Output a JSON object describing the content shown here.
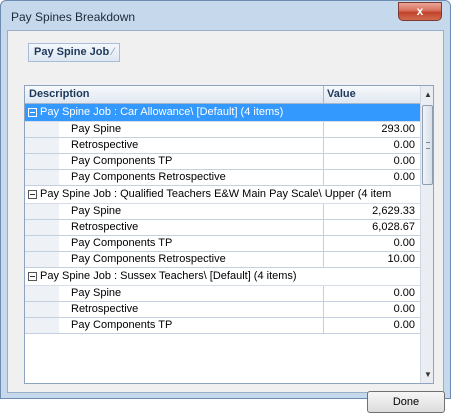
{
  "window": {
    "title": "Pay Spines Breakdown",
    "close_label": "x"
  },
  "group_panel": {
    "chip_label": "Pay Spine Job",
    "sort_glyph": "⁄"
  },
  "grid": {
    "columns": {
      "description": "Description",
      "value": "Value"
    },
    "groups": [
      {
        "label": "Pay Spine Job : Car Allowance\\ [Default] (4 items)",
        "selected": true,
        "rows": [
          {
            "description": "Pay Spine",
            "value": "293.00"
          },
          {
            "description": "Retrospective",
            "value": "0.00"
          },
          {
            "description": "Pay Components TP",
            "value": "0.00"
          },
          {
            "description": "Pay Components Retrospective",
            "value": "0.00"
          }
        ]
      },
      {
        "label": "Pay Spine Job : Qualified Teachers E&W Main Pay Scale\\ Upper (4 item",
        "selected": false,
        "rows": [
          {
            "description": "Pay Spine",
            "value": "2,629.33"
          },
          {
            "description": "Retrospective",
            "value": "6,028.67"
          },
          {
            "description": "Pay Components TP",
            "value": "0.00"
          },
          {
            "description": "Pay Components Retrospective",
            "value": "10.00"
          }
        ]
      },
      {
        "label": "Pay Spine Job : Sussex Teachers\\ [Default] (4 items)",
        "selected": false,
        "rows": [
          {
            "description": "Pay Spine",
            "value": "0.00"
          },
          {
            "description": "Retrospective",
            "value": "0.00"
          },
          {
            "description": "Pay Components TP",
            "value": "0.00"
          }
        ]
      }
    ]
  },
  "footer": {
    "done_label": "Done"
  }
}
